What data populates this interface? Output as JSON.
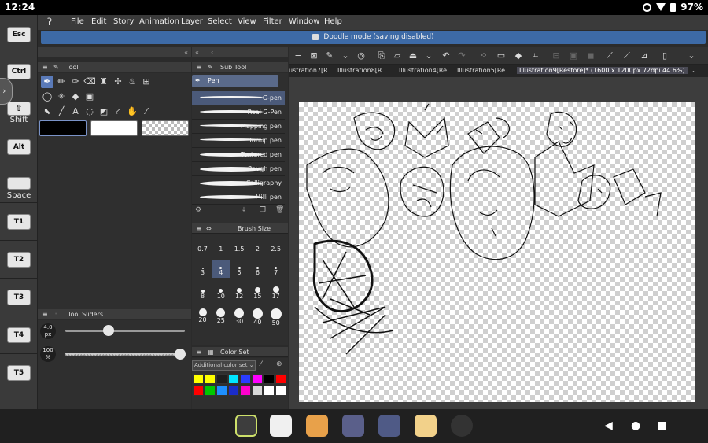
{
  "status_bar": {
    "time": "12:24",
    "battery": "97%"
  },
  "left_panel": {
    "esc": "Esc",
    "ctrl": "Ctrl",
    "shift_label": "Shift",
    "alt": "Alt",
    "space_label": "Space",
    "tkeys": [
      "T1",
      "T2",
      "T3",
      "T4",
      "T5"
    ]
  },
  "menu": [
    "File",
    "Edit",
    "Story",
    "Animation",
    "Layer",
    "Select",
    "View",
    "Filter",
    "Window",
    "Help"
  ],
  "banner": {
    "text": "Doodle mode (saving disabled)"
  },
  "tool_palette": {
    "title": "Tool"
  },
  "subtool_palette": {
    "title": "Sub Tool",
    "group": "Pen",
    "items": [
      "G-pen",
      "Real G-Pen",
      "Mapping pen",
      "Turnip pen",
      "Textured pen",
      "Rough pen",
      "Calligraphy",
      "Milli pen"
    ]
  },
  "brush_size": {
    "title": "Brush Size",
    "sizes": [
      "0.7",
      "1",
      "1.5",
      "2",
      "2.5",
      "3",
      "4",
      "5",
      "6",
      "7",
      "8",
      "10",
      "12",
      "15",
      "17",
      "20",
      "25",
      "30",
      "40",
      "50"
    ],
    "selected": "4"
  },
  "tool_sliders": {
    "title": "Tool Sliders",
    "size_value": "4.0",
    "size_unit": "px",
    "opacity_value": "100",
    "opacity_unit": "%"
  },
  "color_set": {
    "title": "Color Set",
    "dropdown": "Additional color set",
    "row1": [
      "#ffff00",
      "#ffff00",
      "#1e1e1e",
      "#00e5ff",
      "#2a3cff",
      "#ff00ff",
      "#000000",
      "#ff0000"
    ],
    "row2": [
      "#ff0000",
      "#00c800",
      "#1e90ff",
      "#1a2cc8",
      "#ff00cc",
      "#d8d8d8",
      "#ffffff",
      "#ffffff"
    ]
  },
  "tabs": {
    "items": [
      "ustration7[R",
      "Illustration8[R",
      "Illustration4[Re",
      "Illustration5[Re",
      "Illustration9[Restore]* (1600 x 1200px 72dpi 44.6%)"
    ]
  }
}
